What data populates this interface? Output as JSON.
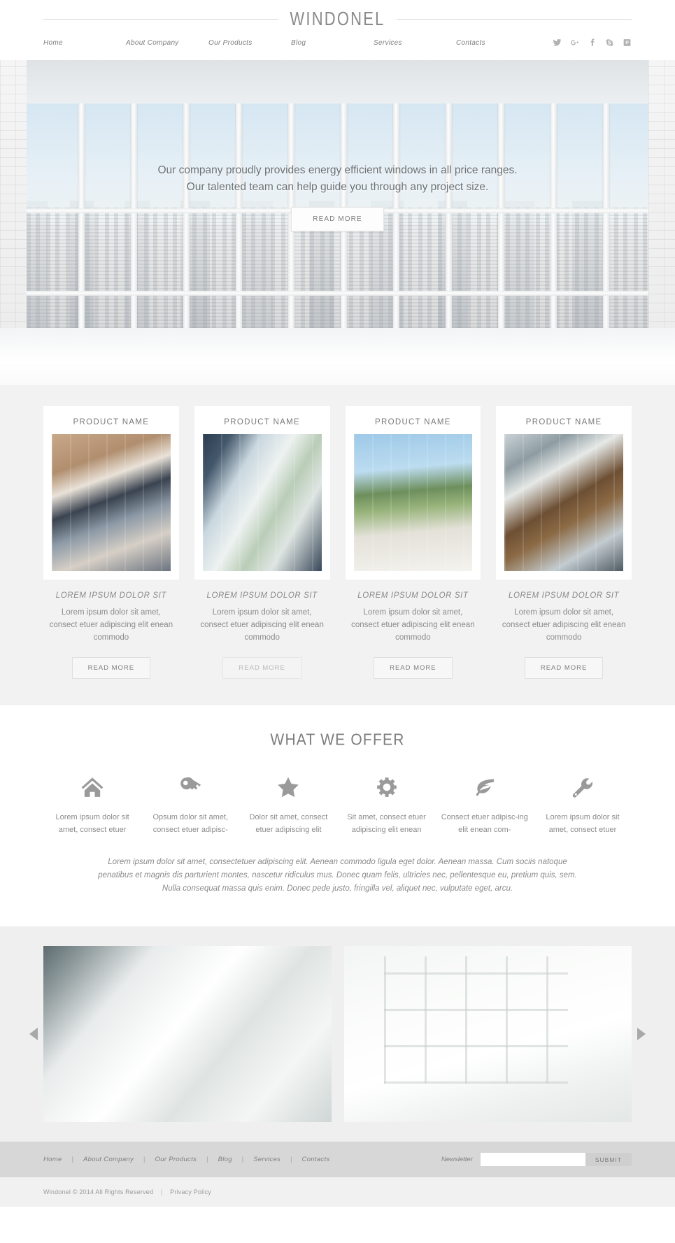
{
  "header": {
    "brand": "WINDONEL",
    "nav": [
      {
        "label": "Home"
      },
      {
        "label": "About Company"
      },
      {
        "label": "Our Products"
      },
      {
        "label": "Blog"
      },
      {
        "label": "Services"
      },
      {
        "label": "Contacts"
      }
    ],
    "social": [
      {
        "name": "twitter-icon"
      },
      {
        "name": "google-plus-icon"
      },
      {
        "name": "facebook-icon"
      },
      {
        "name": "skype-icon"
      },
      {
        "name": "pinterest-icon"
      }
    ]
  },
  "hero": {
    "line1": "Our company proudly provides energy efficient windows  in all price ranges.",
    "line2": "Our talented team can help guide you through any project size.",
    "button": "READ MORE"
  },
  "products": {
    "cards": [
      {
        "title": "PRODUCT NAME",
        "caption": "LOREM IPSUM DOLOR SIT",
        "desc": "Lorem ipsum dolor sit amet, consect etuer adipiscing elit enean commodo",
        "button": "READ MORE"
      },
      {
        "title": "PRODUCT NAME",
        "caption": "LOREM IPSUM DOLOR SIT",
        "desc": "Lorem ipsum dolor sit amet, consect etuer adipiscing elit enean commodo",
        "button": "READ MORE"
      },
      {
        "title": "PRODUCT NAME",
        "caption": "LOREM IPSUM DOLOR SIT",
        "desc": "Lorem ipsum dolor sit amet, consect etuer adipiscing elit enean commodo",
        "button": "READ MORE"
      },
      {
        "title": "PRODUCT NAME",
        "caption": "LOREM IPSUM DOLOR SIT",
        "desc": "Lorem ipsum dolor sit amet, consect etuer adipiscing elit enean commodo",
        "button": "READ MORE"
      }
    ]
  },
  "offer": {
    "heading": "WHAT WE OFFER",
    "features": [
      {
        "icon": "home-icon",
        "text": "Lorem ipsum dolor sit amet, consect etuer"
      },
      {
        "icon": "key-icon",
        "text": "Opsum dolor sit amet, consect etuer adipisc-"
      },
      {
        "icon": "star-icon",
        "text": "Dolor sit amet, consect etuer adipiscing elit"
      },
      {
        "icon": "gear-icon",
        "text": "Sit amet, consect etuer adipiscing elit enean"
      },
      {
        "icon": "leaf-icon",
        "text": "Consect etuer adipisc-ing elit enean com-"
      },
      {
        "icon": "wrench-icon",
        "text": "Lorem ipsum dolor sit amet, consect etuer"
      }
    ],
    "lead": "Lorem ipsum dolor sit amet, consectetuer adipiscing elit. Aenean commodo ligula eget dolor. Aenean massa. Cum sociis natoque penatibus et magnis dis parturient montes, nascetur ridiculus mus. Donec quam felis, ultricies nec, pellentesque eu, pretium quis, sem. Nulla consequat massa quis enim. Donec pede justo, fringilla vel, aliquet nec, vulputate eget, arcu."
  },
  "gallery": {
    "prev": "prev-arrow",
    "next": "next-arrow"
  },
  "footer": {
    "nav": [
      {
        "label": "Home"
      },
      {
        "label": "About Company"
      },
      {
        "label": "Our Products"
      },
      {
        "label": "Blog"
      },
      {
        "label": "Services"
      },
      {
        "label": "Contacts"
      }
    ],
    "separator": "|",
    "newsletter_label": "Newsletter",
    "newsletter_value": "",
    "newsletter_placeholder": "",
    "submit": "SUBMIT",
    "copyright": "Windonel © 2014 All Rights Reserved",
    "copy_separator": "|",
    "privacy": "Privacy Policy"
  },
  "colors": {
    "page_bg": "#ffffff",
    "products_bg": "#f2f2f2",
    "gallery_bg": "#efefef",
    "footer_top_bg": "#d7d7d7",
    "footer_bottom_bg": "#f1f1f1",
    "text": "#8a8a8a",
    "icon": "#9a9a9a"
  }
}
